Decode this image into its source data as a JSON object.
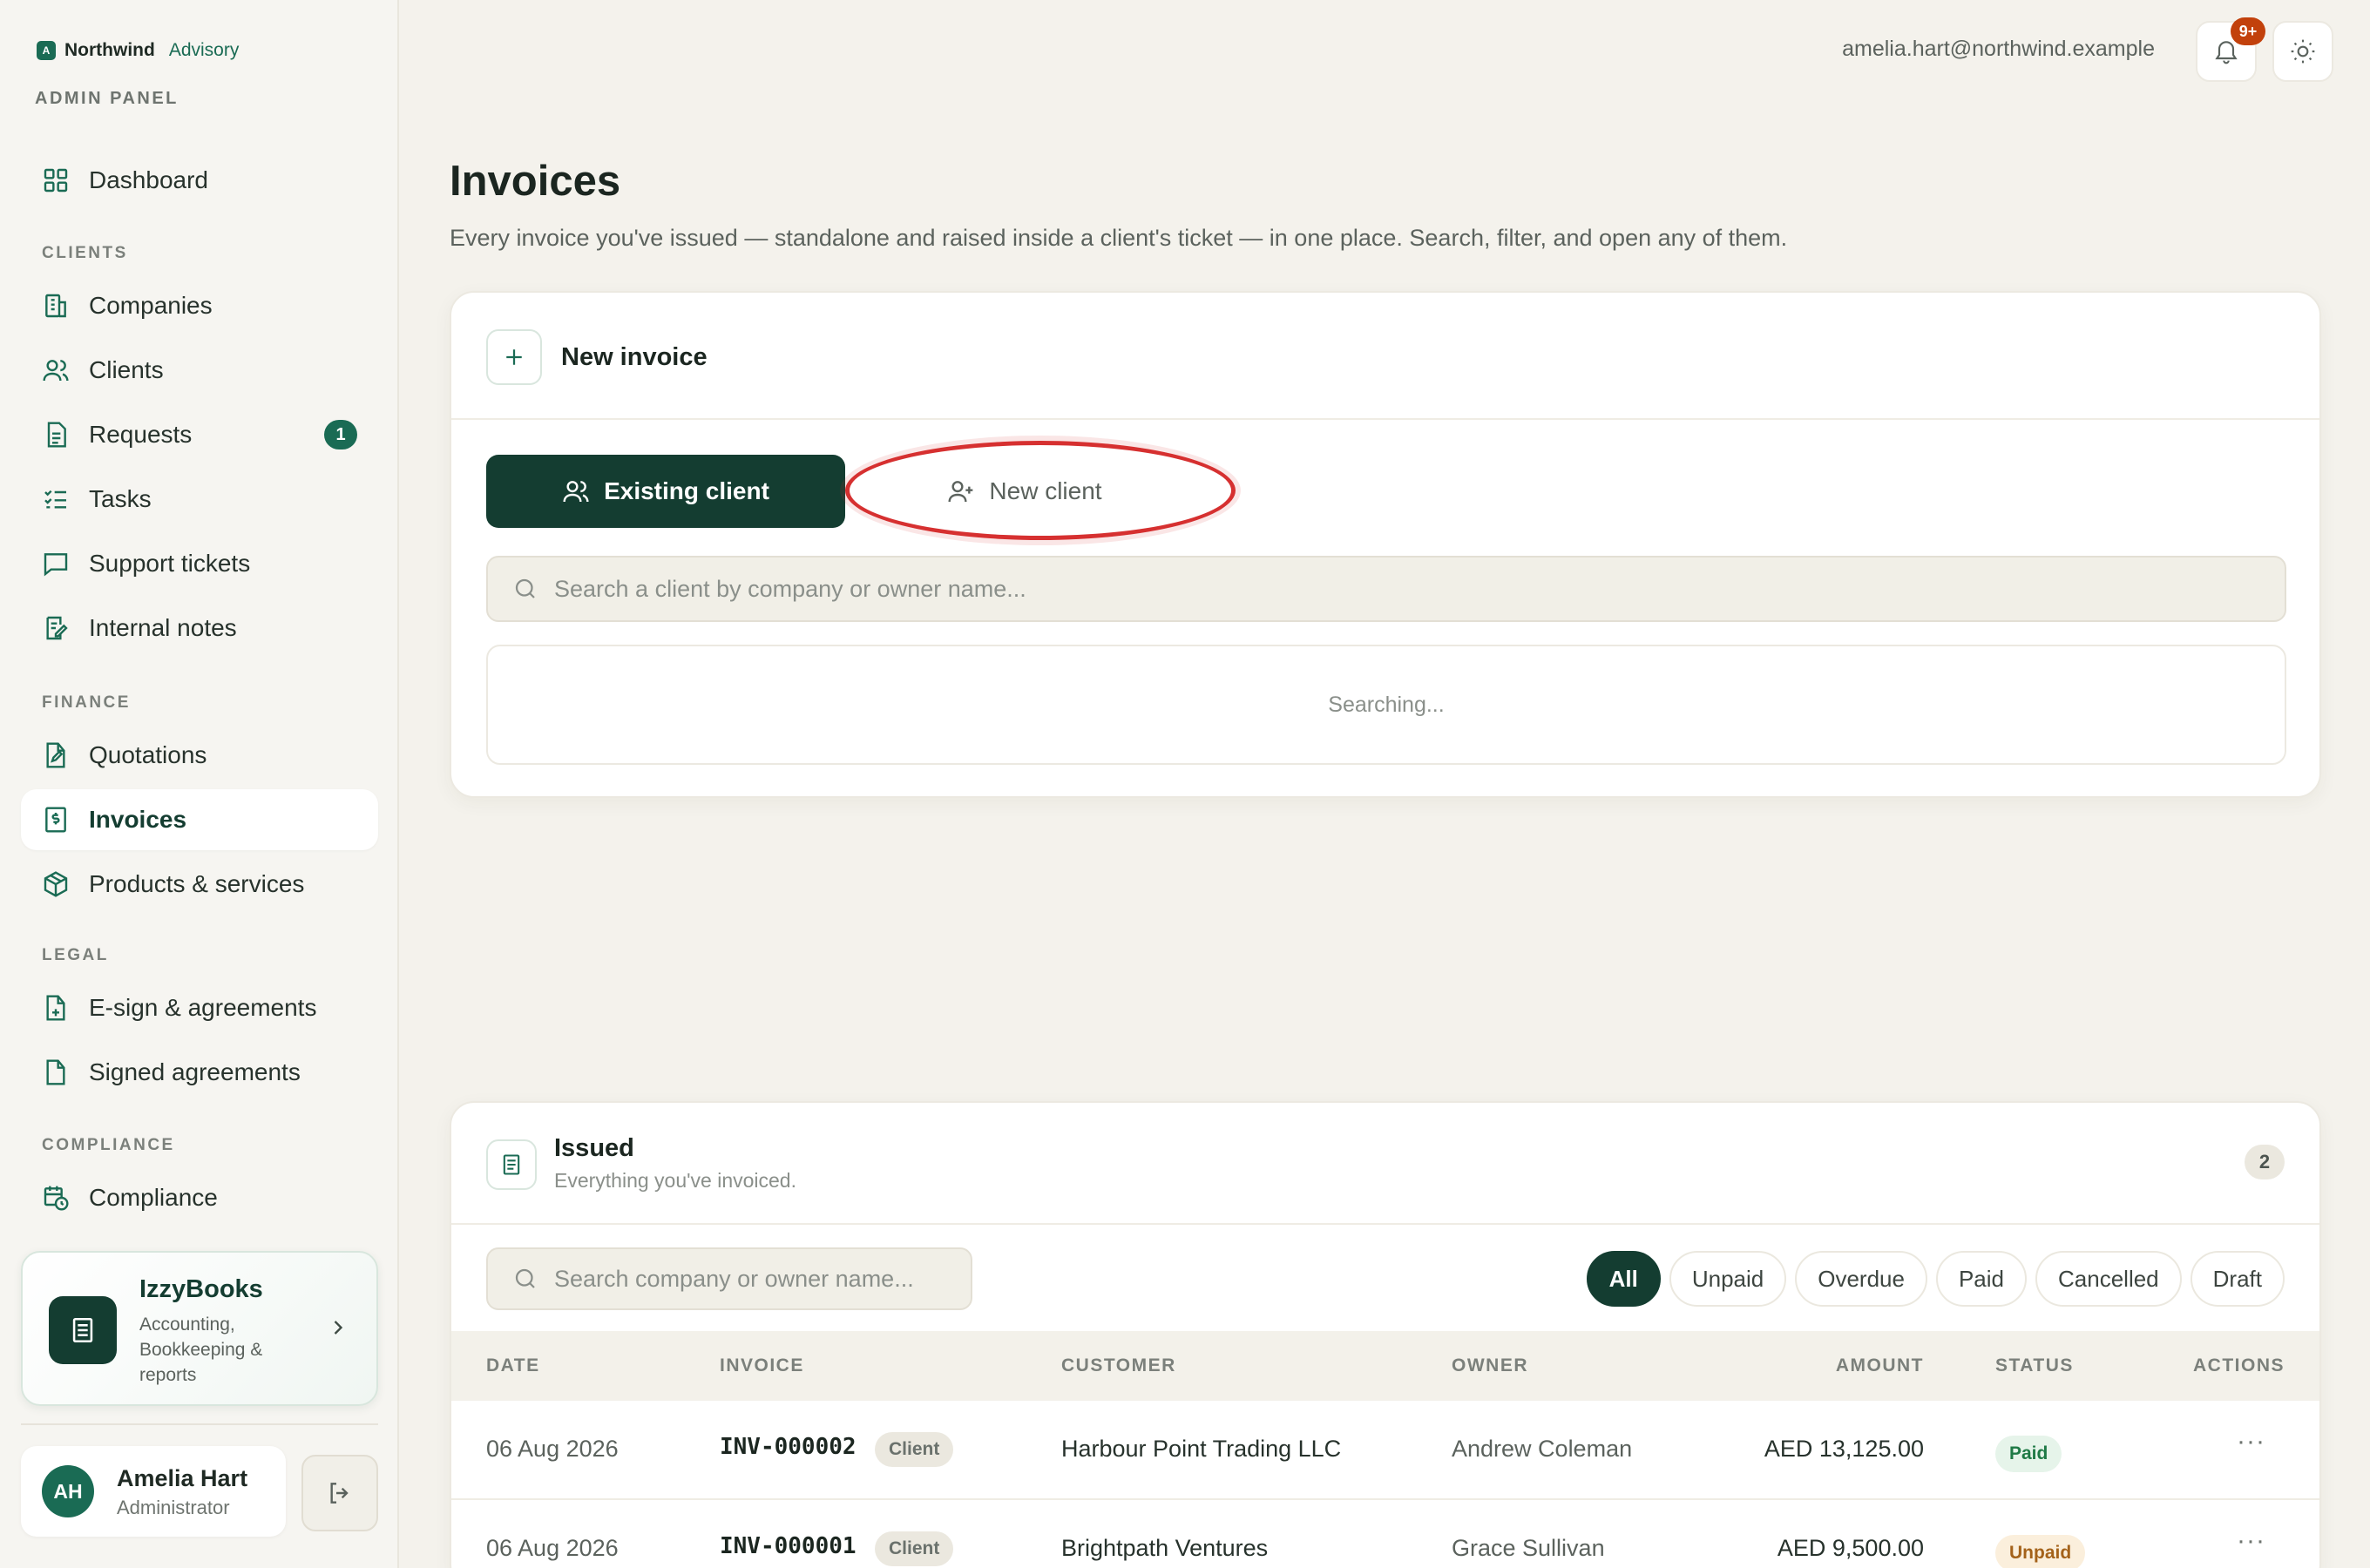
{
  "brand": {
    "logo": "A",
    "name": "Northwind",
    "sub": "Advisory",
    "panel": "ADMIN PANEL"
  },
  "sidebar": {
    "dashboard": "Dashboard",
    "sections": {
      "clients": "CLIENTS",
      "finance": "FINANCE",
      "legal": "LEGAL",
      "compliance": "COMPLIANCE"
    },
    "items": {
      "companies": "Companies",
      "clients": "Clients",
      "requests": "Requests",
      "requests_badge": "1",
      "tasks": "Tasks",
      "support": "Support tickets",
      "notes": "Internal notes",
      "quotations": "Quotations",
      "invoices": "Invoices",
      "products": "Products & services",
      "esign": "E-sign & agreements",
      "signed": "Signed agreements",
      "compliance": "Compliance"
    },
    "promo": {
      "title": "IzzyBooks",
      "desc": "Accounting, Bookkeeping & reports"
    },
    "user": {
      "initials": "AH",
      "name": "Amelia Hart",
      "role": "Administrator"
    }
  },
  "topbar": {
    "email": "amelia.hart@northwind.example",
    "notif_badge": "9+"
  },
  "page": {
    "title": "Invoices",
    "subtitle": "Every invoice you've issued — standalone and raised inside a client's ticket — in one place. Search, filter, and open any of them."
  },
  "new_invoice": {
    "title": "New invoice",
    "tab_existing": "Existing client",
    "tab_new": "New client",
    "search_placeholder": "Search a client by company or owner name...",
    "status": "Searching..."
  },
  "issued": {
    "title": "Issued",
    "subtitle": "Everything you've invoiced.",
    "count": "2",
    "search_placeholder": "Search company or owner name...",
    "filters": [
      "All",
      "Unpaid",
      "Overdue",
      "Paid",
      "Cancelled",
      "Draft"
    ],
    "columns": {
      "date": "DATE",
      "invoice": "INVOICE",
      "customer": "CUSTOMER",
      "owner": "OWNER",
      "amount": "AMOUNT",
      "status": "STATUS",
      "actions": "ACTIONS"
    },
    "rows": [
      {
        "date": "06 Aug 2026",
        "invoice": "INV-000002",
        "tag": "Client",
        "customer": "Harbour Point Trading LLC",
        "owner": "Andrew Coleman",
        "amount": "AED 13,125.00",
        "status": "Paid"
      },
      {
        "date": "06 Aug 2026",
        "invoice": "INV-000001",
        "tag": "Client",
        "customer": "Brightpath Ventures",
        "owner": "Grace Sullivan",
        "amount": "AED 9,500.00",
        "status": "Unpaid"
      }
    ]
  },
  "colors": {
    "accent": "#1a6b54",
    "accent_dark": "#143d31",
    "highlight": "#d63030",
    "badge": "#c2410c"
  }
}
